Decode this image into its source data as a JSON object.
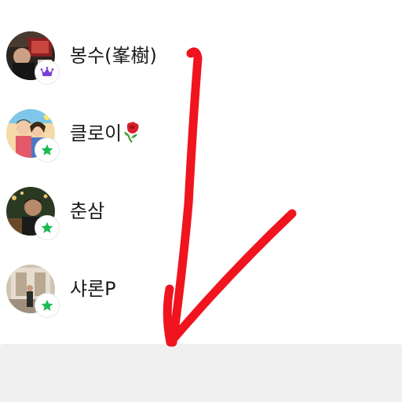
{
  "members": [
    {
      "name": "봉수(峯樹)",
      "role_badge": "crown-icon",
      "badge_color": "#7B3FD6"
    },
    {
      "name": "클로이",
      "name_emoji": "rose-icon",
      "role_badge": "star-icon",
      "badge_color": "#1DB954"
    },
    {
      "name": "춘삼",
      "role_badge": "star-icon",
      "badge_color": "#1DB954"
    },
    {
      "name": "샤론P",
      "role_badge": "star-icon",
      "badge_color": "#1DB954"
    }
  ],
  "annotation": {
    "arrow_color": "#F0141E",
    "icon": "hand-drawn-arrow-down-icon"
  }
}
